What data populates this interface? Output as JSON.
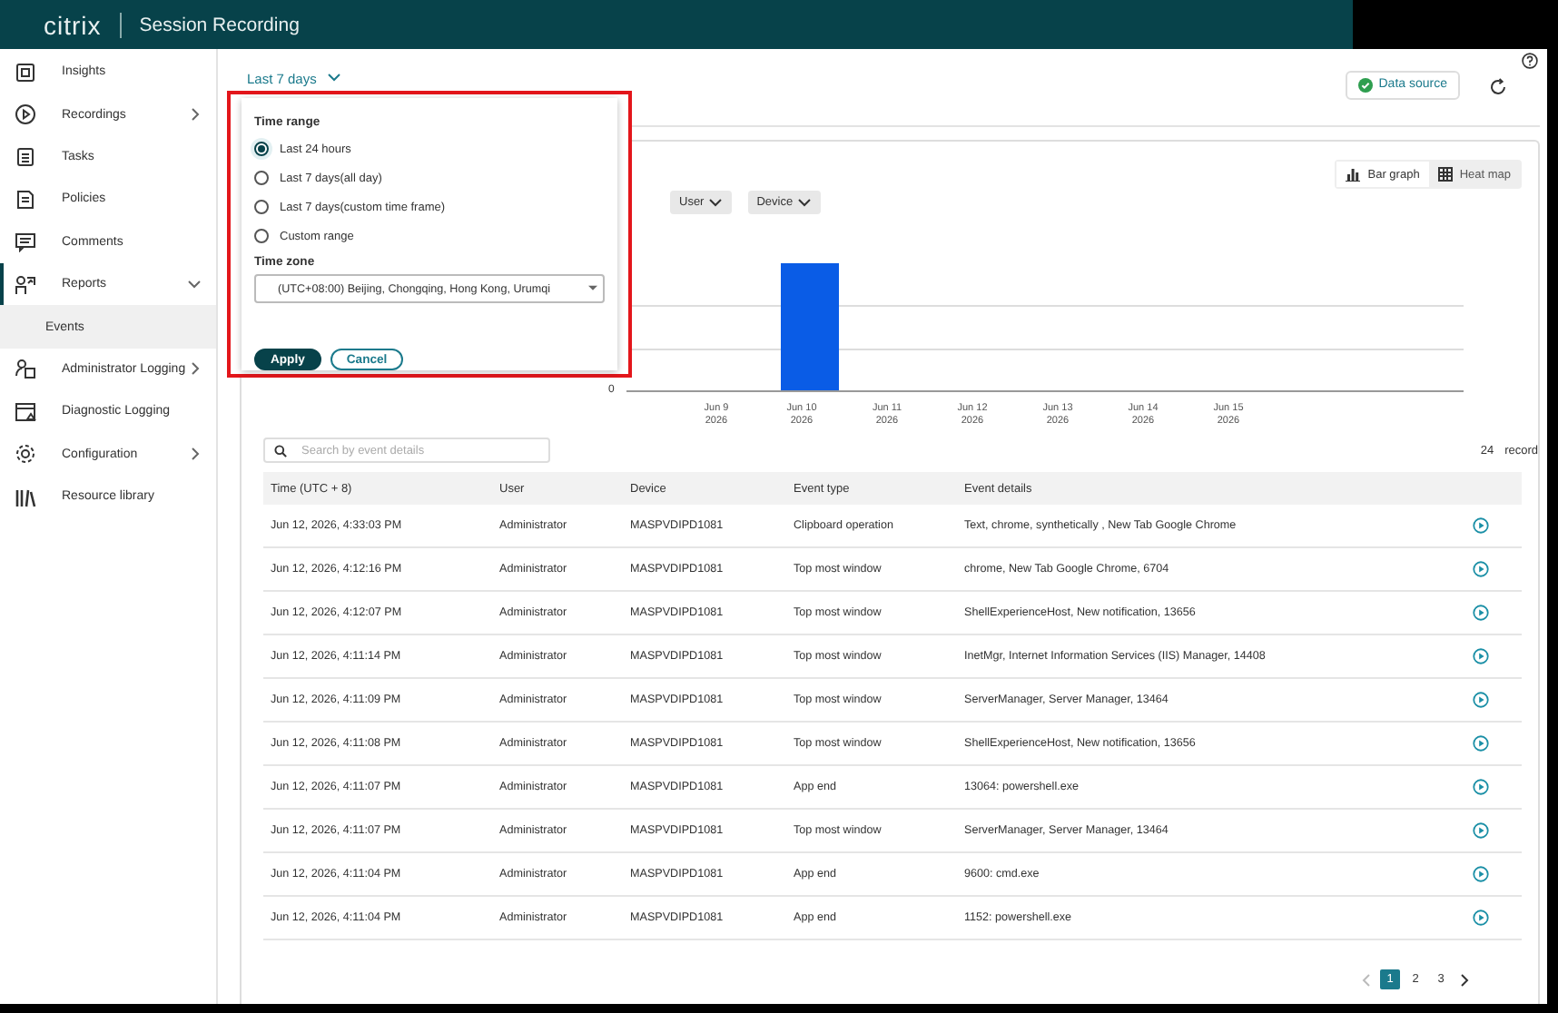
{
  "header": {
    "logo": "citrix",
    "title": "Session Recording"
  },
  "sidebar": {
    "items": [
      {
        "label": "Insights",
        "expandable": false
      },
      {
        "label": "Recordings",
        "expandable": true,
        "expanded": false
      },
      {
        "label": "Tasks",
        "expandable": false
      },
      {
        "label": "Policies",
        "expandable": false
      },
      {
        "label": "Comments",
        "expandable": false
      },
      {
        "label": "Reports",
        "expandable": true,
        "expanded": true,
        "children": [
          {
            "label": "Events",
            "selected": true
          }
        ]
      },
      {
        "label": "Administrator Logging",
        "expandable": true,
        "expanded": false
      },
      {
        "label": "Diagnostic Logging",
        "expandable": false
      },
      {
        "label": "Configuration",
        "expandable": true,
        "expanded": false
      },
      {
        "label": "Resource library",
        "expandable": false
      }
    ]
  },
  "range_trigger": "Last 7 days",
  "data_source": "Data source",
  "popup": {
    "title": "Time range",
    "options": [
      {
        "label": "Last 24 hours",
        "selected": true
      },
      {
        "label": "Last 7 days(all day)",
        "selected": false
      },
      {
        "label": "Last 7 days(custom time frame)",
        "selected": false
      },
      {
        "label": "Custom range",
        "selected": false
      }
    ],
    "timezone_label": "Time zone",
    "timezone": "(UTC+08:00) Beijing, Chongqing, Hong Kong, Urumqi",
    "apply": "Apply",
    "cancel": "Cancel"
  },
  "views": [
    {
      "label": "Bar graph",
      "selected": true
    },
    {
      "label": "Heat map",
      "selected": false
    }
  ],
  "filters": [
    "User",
    "Device"
  ],
  "chart": {
    "y_label": "0",
    "categories": [
      {
        "date": "Jun 9",
        "year": "2026",
        "bar": false
      },
      {
        "date": "Jun 10",
        "year": "2026",
        "bar": true
      },
      {
        "date": "Jun 11",
        "year": "2026",
        "bar": false
      },
      {
        "date": "Jun 12",
        "year": "2026",
        "bar": false
      },
      {
        "date": "Jun 13",
        "year": "2026",
        "bar": false
      },
      {
        "date": "Jun 14",
        "year": "2026",
        "bar": false
      },
      {
        "date": "Jun 15",
        "year": "2026",
        "bar": false
      }
    ]
  },
  "search": {
    "placeholder": "Search by event details"
  },
  "record_count": "24",
  "record_label": "record",
  "table": {
    "columns": [
      "Time (UTC + 8)",
      "User",
      "Device",
      "Event type",
      "Event details"
    ],
    "rows": [
      [
        "Jun 12, 2026, 4:33:03 PM",
        "Administrator",
        "MASPVDIPD1081",
        "Clipboard operation",
        "Text, chrome, synthetically , New Tab  Google Chrome"
      ],
      [
        "Jun 12, 2026, 4:12:16 PM",
        "Administrator",
        "MASPVDIPD1081",
        "Top most window",
        "chrome, New Tab  Google Chrome, 6704"
      ],
      [
        "Jun 12, 2026, 4:12:07 PM",
        "Administrator",
        "MASPVDIPD1081",
        "Top most window",
        "ShellExperienceHost, New notification, 13656"
      ],
      [
        "Jun 12, 2026, 4:11:14 PM",
        "Administrator",
        "MASPVDIPD1081",
        "Top most window",
        "InetMgr, Internet Information Services (IIS) Manager, 14408"
      ],
      [
        "Jun 12, 2026, 4:11:09 PM",
        "Administrator",
        "MASPVDIPD1081",
        "Top most window",
        "ServerManager, Server Manager, 13464"
      ],
      [
        "Jun 12, 2026, 4:11:08 PM",
        "Administrator",
        "MASPVDIPD1081",
        "Top most window",
        "ShellExperienceHost, New notification, 13656"
      ],
      [
        "Jun 12, 2026, 4:11:07 PM",
        "Administrator",
        "MASPVDIPD1081",
        "App end",
        "13064: powershell.exe"
      ],
      [
        "Jun 12, 2026, 4:11:07 PM",
        "Administrator",
        "MASPVDIPD1081",
        "Top most window",
        "ServerManager, Server Manager, 13464"
      ],
      [
        "Jun 12, 2026, 4:11:04 PM",
        "Administrator",
        "MASPVDIPD1081",
        "App end",
        "9600: cmd.exe"
      ],
      [
        "Jun 12, 2026, 4:11:04 PM",
        "Administrator",
        "MASPVDIPD1081",
        "App end",
        "1152: powershell.exe"
      ]
    ]
  },
  "pagination": {
    "prev_disabled": true,
    "next_disabled": false,
    "pages": [
      {
        "label": "1",
        "selected": true
      },
      {
        "label": "2",
        "selected": false
      },
      {
        "label": "3",
        "selected": false
      }
    ]
  }
}
